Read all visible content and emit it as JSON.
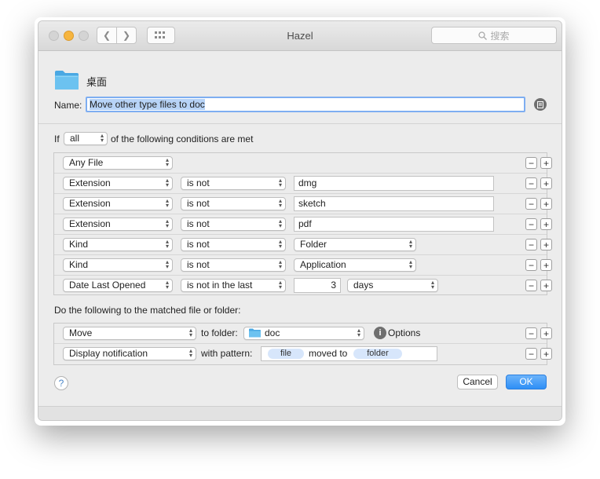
{
  "window": {
    "title": "Hazel",
    "search_placeholder": "搜索"
  },
  "folder": {
    "name": "桌面"
  },
  "rule_name": {
    "label": "Name:",
    "value": "Move other type files to doc"
  },
  "conditions": {
    "prefix": "If",
    "match_mode": "all",
    "suffix": "of the following conditions are met",
    "rows": [
      {
        "attribute": "Any File"
      },
      {
        "attribute": "Extension",
        "operator": "is not",
        "value": "dmg"
      },
      {
        "attribute": "Extension",
        "operator": "is not",
        "value": "sketch"
      },
      {
        "attribute": "Extension",
        "operator": "is not",
        "value": "pdf"
      },
      {
        "attribute": "Kind",
        "operator": "is not",
        "value": "Folder"
      },
      {
        "attribute": "Kind",
        "operator": "is not",
        "value": "Application"
      },
      {
        "attribute": "Date Last Opened",
        "operator": "is not in the last",
        "amount": "3",
        "unit": "days"
      }
    ]
  },
  "actions": {
    "heading": "Do the following to the matched file or folder:",
    "rows": [
      {
        "action": "Move",
        "connector": "to folder:",
        "target": "doc",
        "options_label": "Options"
      },
      {
        "action": "Display notification",
        "connector": "with pattern:",
        "pattern": [
          "file",
          "moved to",
          "folder"
        ]
      }
    ]
  },
  "buttons": {
    "cancel": "Cancel",
    "ok": "OK",
    "help": "?"
  },
  "colors": {
    "accent": "#2e8ff6",
    "folder": "#5cb8ec",
    "close_btn": "#f6b53f"
  }
}
